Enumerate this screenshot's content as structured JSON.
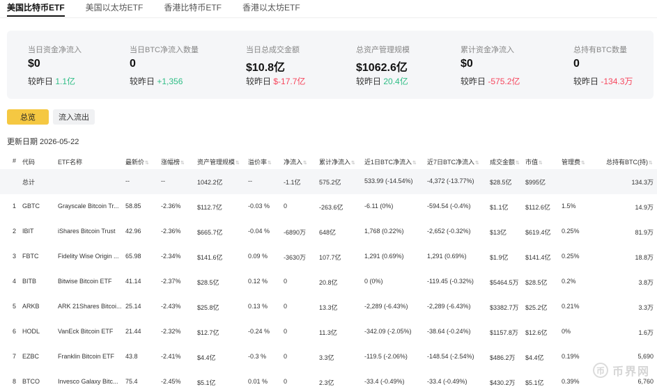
{
  "tabs": [
    "美国比特币ETF",
    "美国以太坊ETF",
    "香港比特币ETF",
    "香港以太坊ETF"
  ],
  "summary": [
    {
      "label": "当日资金净流入",
      "value": "$0",
      "change_prefix": "较昨日",
      "change": "1.1亿",
      "dir": "up"
    },
    {
      "label": "当日BTC净流入数量",
      "value": "0",
      "change_prefix": "较昨日",
      "change": "+1,356",
      "dir": "up"
    },
    {
      "label": "当日总成交金额",
      "value": "$10.8亿",
      "change_prefix": "较昨日",
      "change": "$-17.7亿",
      "dir": "down"
    },
    {
      "label": "总资产管理规模",
      "value": "$1062.6亿",
      "change_prefix": "较昨日",
      "change": "20.4亿",
      "dir": "up"
    },
    {
      "label": "累计资金净流入",
      "value": "$0",
      "change_prefix": "较昨日",
      "change": "-575.2亿",
      "dir": "down"
    },
    {
      "label": "总持有BTC数量",
      "value": "0",
      "change_prefix": "较昨日",
      "change": "-134.3万",
      "dir": "down"
    }
  ],
  "buttons": {
    "total": "总览",
    "flow": "流入流出"
  },
  "update_date": "更新日期 2026-05-22",
  "table": {
    "headers": [
      "#",
      "代码",
      "ETF名称",
      "最新价",
      "涨幅榜",
      "资产管理规模",
      "溢价率",
      "净流入",
      "累计净流入",
      "近1日BTC净流入",
      "近7日BTC净流入",
      "成交金额",
      "市值",
      "管理费",
      "总持有BTC(持)"
    ],
    "total_row": {
      "label": "总计",
      "price": "--",
      "change": "--",
      "aum": "1042.2亿",
      "premium": "--",
      "inflow": "-1.1亿",
      "cum_inflow": "575.2亿",
      "btc1d": "533.99 (-14.54%)",
      "btc7d": "-4,372 (-13.77%)",
      "volume": "$28.5亿",
      "mcap": "$995亿",
      "fee": "",
      "holdings": "134.3万"
    },
    "rows": [
      {
        "num": "1",
        "code": "GBTC",
        "name": "Grayscale Bitcoin Tr...",
        "price": "58.85",
        "change": "-2.36%",
        "aum": "$112.7亿",
        "premium": "-0.03 %",
        "inflow": "0",
        "cum_inflow": "-263.6亿",
        "btc1d": "-6.11 (0%)",
        "btc7d": "-594.54 (-0.4%)",
        "volume": "$1.1亿",
        "mcap": "$112.6亿",
        "fee": "1.5%",
        "holdings": "14.9万"
      },
      {
        "num": "2",
        "code": "IBIT",
        "name": "iShares Bitcoin Trust",
        "price": "42.96",
        "change": "-2.36%",
        "aum": "$665.7亿",
        "premium": "-0.04 %",
        "inflow": "-6890万",
        "cum_inflow": "648亿",
        "btc1d": "1,768 (0.22%)",
        "btc7d": "-2,652 (-0.32%)",
        "volume": "$13亿",
        "mcap": "$619.4亿",
        "fee": "0.25%",
        "holdings": "81.9万"
      },
      {
        "num": "3",
        "code": "FBTC",
        "name": "Fidelity Wise Origin ...",
        "price": "65.98",
        "change": "-2.34%",
        "aum": "$141.6亿",
        "premium": "0.09 %",
        "inflow": "-3630万",
        "cum_inflow": "107.7亿",
        "btc1d": "1,291 (0.69%)",
        "btc7d": "1,291 (0.69%)",
        "volume": "$1.9亿",
        "mcap": "$141.4亿",
        "fee": "0.25%",
        "holdings": "18.8万"
      },
      {
        "num": "4",
        "code": "BITB",
        "name": "Bitwise Bitcoin ETF",
        "price": "41.14",
        "change": "-2.37%",
        "aum": "$28.5亿",
        "premium": "0.12 %",
        "inflow": "0",
        "cum_inflow": "20.8亿",
        "btc1d": "0 (0%)",
        "btc7d": "-119.45 (-0.32%)",
        "volume": "$5464.5万",
        "mcap": "$28.5亿",
        "fee": "0.2%",
        "holdings": "3.8万"
      },
      {
        "num": "5",
        "code": "ARKB",
        "name": "ARK 21Shares Bitcoi...",
        "price": "25.14",
        "change": "-2.43%",
        "aum": "$25.8亿",
        "premium": "0.13 %",
        "inflow": "0",
        "cum_inflow": "13.3亿",
        "btc1d": "-2,289 (-6.43%)",
        "btc7d": "-2,289 (-6.43%)",
        "volume": "$3382.7万",
        "mcap": "$25.2亿",
        "fee": "0.21%",
        "holdings": "3.3万"
      },
      {
        "num": "6",
        "code": "HODL",
        "name": "VanEck Bitcoin ETF",
        "price": "21.44",
        "change": "-2.32%",
        "aum": "$12.7亿",
        "premium": "-0.24 %",
        "inflow": "0",
        "cum_inflow": "11.3亿",
        "btc1d": "-342.09 (-2.05%)",
        "btc7d": "-38.64 (-0.24%)",
        "volume": "$1157.8万",
        "mcap": "$12.6亿",
        "fee": "0%",
        "holdings": "1.6万"
      },
      {
        "num": "7",
        "code": "EZBC",
        "name": "Franklin Bitcoin ETF",
        "price": "43.8",
        "change": "-2.41%",
        "aum": "$4.4亿",
        "premium": "-0.3 %",
        "inflow": "0",
        "cum_inflow": "3.3亿",
        "btc1d": "-119.5 (-2.06%)",
        "btc7d": "-148.54 (-2.54%)",
        "volume": "$486.2万",
        "mcap": "$4.4亿",
        "fee": "0.19%",
        "holdings": "5,690"
      },
      {
        "num": "8",
        "code": "BTCO",
        "name": "Invesco Galaxy Bitc...",
        "price": "75.4",
        "change": "-2.45%",
        "aum": "$5.1亿",
        "premium": "0.01 %",
        "inflow": "0",
        "cum_inflow": "2.3亿",
        "btc1d": "-33.4 (-0.49%)",
        "btc7d": "-33.4 (-0.49%)",
        "volume": "$430.2万",
        "mcap": "$5.1亿",
        "fee": "0.39%",
        "holdings": "6,760"
      }
    ]
  },
  "watermark": {
    "icon": "币",
    "text": "币界网"
  },
  "colors": {
    "up": "#2ebd85",
    "down": "#f6465d",
    "accent": "#f5c842"
  }
}
